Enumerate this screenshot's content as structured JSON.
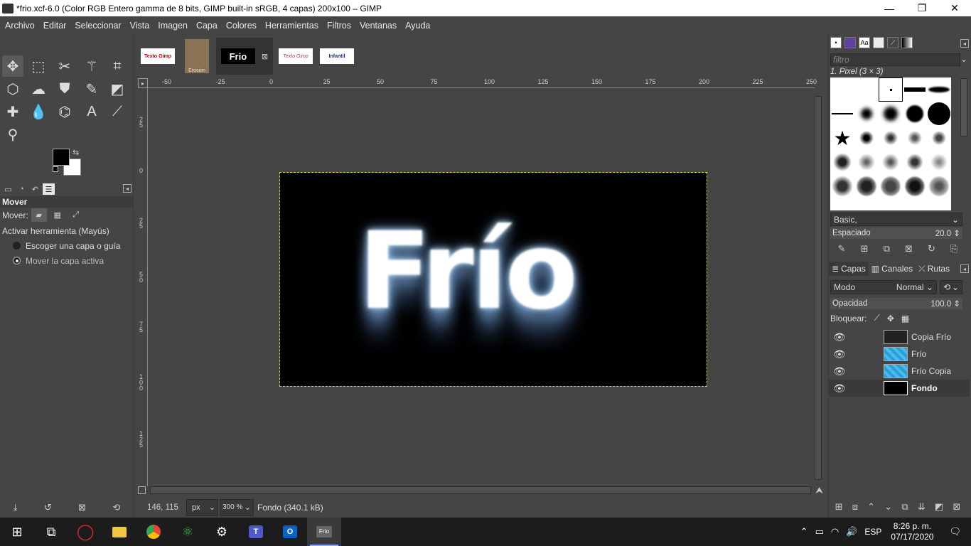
{
  "window": {
    "title": "*frio.xcf-6.0 (Color RGB Entero gamma de 8 bits, GIMP built-in sRGB, 4 capas) 200x100 – GIMP",
    "minimize": "—",
    "maximize": "❐",
    "close": "✕"
  },
  "menu": [
    "Archivo",
    "Editar",
    "Seleccionar",
    "Vista",
    "Imagen",
    "Capa",
    "Colores",
    "Herramientas",
    "Filtros",
    "Ventanas",
    "Ayuda"
  ],
  "image_tabs": [
    {
      "label": "Texto Gimp",
      "color": "#cc0000"
    },
    {
      "label": "Erosion",
      "color": "#8a7355"
    },
    {
      "label": "Frio",
      "color": "#000000"
    },
    {
      "label": "Texto Gimp",
      "color": "#aa4466"
    },
    {
      "label": "Infantil",
      "color": "#1a2a99"
    }
  ],
  "tool_options": {
    "title": "Mover",
    "mover_label": "Mover:",
    "toggle_label": "Activar herramienta  (Mayús)",
    "option1": "Escoger una capa o guía",
    "option2": "Mover la capa activa"
  },
  "canvas": {
    "text": "Frío",
    "ruler_top": [
      "-50",
      "-25",
      "0",
      "25",
      "50",
      "75",
      "100",
      "125",
      "150",
      "175",
      "200",
      "225",
      "250"
    ],
    "ruler_left": [
      "2\n5",
      "0",
      "2\n5",
      "5\n0",
      "7\n5",
      "1\n0\n0",
      "1\n2\n5"
    ]
  },
  "status": {
    "coords": "146, 115",
    "unit": "px",
    "zoom": "300 %",
    "message": "Fondo (340.1 kB)"
  },
  "brushes": {
    "filter_placeholder": "filtro",
    "current": "1. Pixel (3 × 3)",
    "tag": "Basic,",
    "spacing_label": "Espaciado",
    "spacing_value": "20.0"
  },
  "layers_panel": {
    "tabs": [
      "Capas",
      "Canales",
      "Rutas"
    ],
    "mode_label": "Modo",
    "mode_value": "Normal",
    "opacity_label": "Opacidad",
    "opacity_value": "100.0",
    "lock_label": "Bloquear:",
    "layers": [
      {
        "name": "Copia Frío",
        "active": false
      },
      {
        "name": "Frío",
        "active": false
      },
      {
        "name": "Frío Copia",
        "active": false
      },
      {
        "name": "Fondo",
        "active": true
      }
    ]
  },
  "taskbar": {
    "lang": "ESP",
    "time": "8:26 p. m.",
    "date": "07/17/2020"
  }
}
